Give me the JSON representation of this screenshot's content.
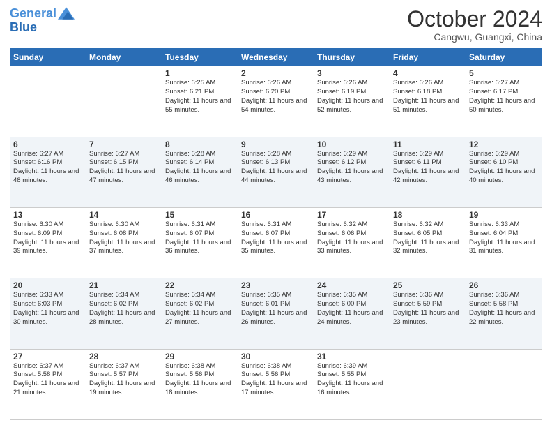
{
  "header": {
    "logo_line1": "General",
    "logo_line2": "Blue",
    "month": "October 2024",
    "location": "Cangwu, Guangxi, China"
  },
  "weekdays": [
    "Sunday",
    "Monday",
    "Tuesday",
    "Wednesday",
    "Thursday",
    "Friday",
    "Saturday"
  ],
  "weeks": [
    [
      {
        "day": "",
        "info": ""
      },
      {
        "day": "",
        "info": ""
      },
      {
        "day": "1",
        "info": "Sunrise: 6:25 AM\nSunset: 6:21 PM\nDaylight: 11 hours and 55 minutes."
      },
      {
        "day": "2",
        "info": "Sunrise: 6:26 AM\nSunset: 6:20 PM\nDaylight: 11 hours and 54 minutes."
      },
      {
        "day": "3",
        "info": "Sunrise: 6:26 AM\nSunset: 6:19 PM\nDaylight: 11 hours and 52 minutes."
      },
      {
        "day": "4",
        "info": "Sunrise: 6:26 AM\nSunset: 6:18 PM\nDaylight: 11 hours and 51 minutes."
      },
      {
        "day": "5",
        "info": "Sunrise: 6:27 AM\nSunset: 6:17 PM\nDaylight: 11 hours and 50 minutes."
      }
    ],
    [
      {
        "day": "6",
        "info": "Sunrise: 6:27 AM\nSunset: 6:16 PM\nDaylight: 11 hours and 48 minutes."
      },
      {
        "day": "7",
        "info": "Sunrise: 6:27 AM\nSunset: 6:15 PM\nDaylight: 11 hours and 47 minutes."
      },
      {
        "day": "8",
        "info": "Sunrise: 6:28 AM\nSunset: 6:14 PM\nDaylight: 11 hours and 46 minutes."
      },
      {
        "day": "9",
        "info": "Sunrise: 6:28 AM\nSunset: 6:13 PM\nDaylight: 11 hours and 44 minutes."
      },
      {
        "day": "10",
        "info": "Sunrise: 6:29 AM\nSunset: 6:12 PM\nDaylight: 11 hours and 43 minutes."
      },
      {
        "day": "11",
        "info": "Sunrise: 6:29 AM\nSunset: 6:11 PM\nDaylight: 11 hours and 42 minutes."
      },
      {
        "day": "12",
        "info": "Sunrise: 6:29 AM\nSunset: 6:10 PM\nDaylight: 11 hours and 40 minutes."
      }
    ],
    [
      {
        "day": "13",
        "info": "Sunrise: 6:30 AM\nSunset: 6:09 PM\nDaylight: 11 hours and 39 minutes."
      },
      {
        "day": "14",
        "info": "Sunrise: 6:30 AM\nSunset: 6:08 PM\nDaylight: 11 hours and 37 minutes."
      },
      {
        "day": "15",
        "info": "Sunrise: 6:31 AM\nSunset: 6:07 PM\nDaylight: 11 hours and 36 minutes."
      },
      {
        "day": "16",
        "info": "Sunrise: 6:31 AM\nSunset: 6:07 PM\nDaylight: 11 hours and 35 minutes."
      },
      {
        "day": "17",
        "info": "Sunrise: 6:32 AM\nSunset: 6:06 PM\nDaylight: 11 hours and 33 minutes."
      },
      {
        "day": "18",
        "info": "Sunrise: 6:32 AM\nSunset: 6:05 PM\nDaylight: 11 hours and 32 minutes."
      },
      {
        "day": "19",
        "info": "Sunrise: 6:33 AM\nSunset: 6:04 PM\nDaylight: 11 hours and 31 minutes."
      }
    ],
    [
      {
        "day": "20",
        "info": "Sunrise: 6:33 AM\nSunset: 6:03 PM\nDaylight: 11 hours and 30 minutes."
      },
      {
        "day": "21",
        "info": "Sunrise: 6:34 AM\nSunset: 6:02 PM\nDaylight: 11 hours and 28 minutes."
      },
      {
        "day": "22",
        "info": "Sunrise: 6:34 AM\nSunset: 6:02 PM\nDaylight: 11 hours and 27 minutes."
      },
      {
        "day": "23",
        "info": "Sunrise: 6:35 AM\nSunset: 6:01 PM\nDaylight: 11 hours and 26 minutes."
      },
      {
        "day": "24",
        "info": "Sunrise: 6:35 AM\nSunset: 6:00 PM\nDaylight: 11 hours and 24 minutes."
      },
      {
        "day": "25",
        "info": "Sunrise: 6:36 AM\nSunset: 5:59 PM\nDaylight: 11 hours and 23 minutes."
      },
      {
        "day": "26",
        "info": "Sunrise: 6:36 AM\nSunset: 5:58 PM\nDaylight: 11 hours and 22 minutes."
      }
    ],
    [
      {
        "day": "27",
        "info": "Sunrise: 6:37 AM\nSunset: 5:58 PM\nDaylight: 11 hours and 21 minutes."
      },
      {
        "day": "28",
        "info": "Sunrise: 6:37 AM\nSunset: 5:57 PM\nDaylight: 11 hours and 19 minutes."
      },
      {
        "day": "29",
        "info": "Sunrise: 6:38 AM\nSunset: 5:56 PM\nDaylight: 11 hours and 18 minutes."
      },
      {
        "day": "30",
        "info": "Sunrise: 6:38 AM\nSunset: 5:56 PM\nDaylight: 11 hours and 17 minutes."
      },
      {
        "day": "31",
        "info": "Sunrise: 6:39 AM\nSunset: 5:55 PM\nDaylight: 11 hours and 16 minutes."
      },
      {
        "day": "",
        "info": ""
      },
      {
        "day": "",
        "info": ""
      }
    ]
  ]
}
